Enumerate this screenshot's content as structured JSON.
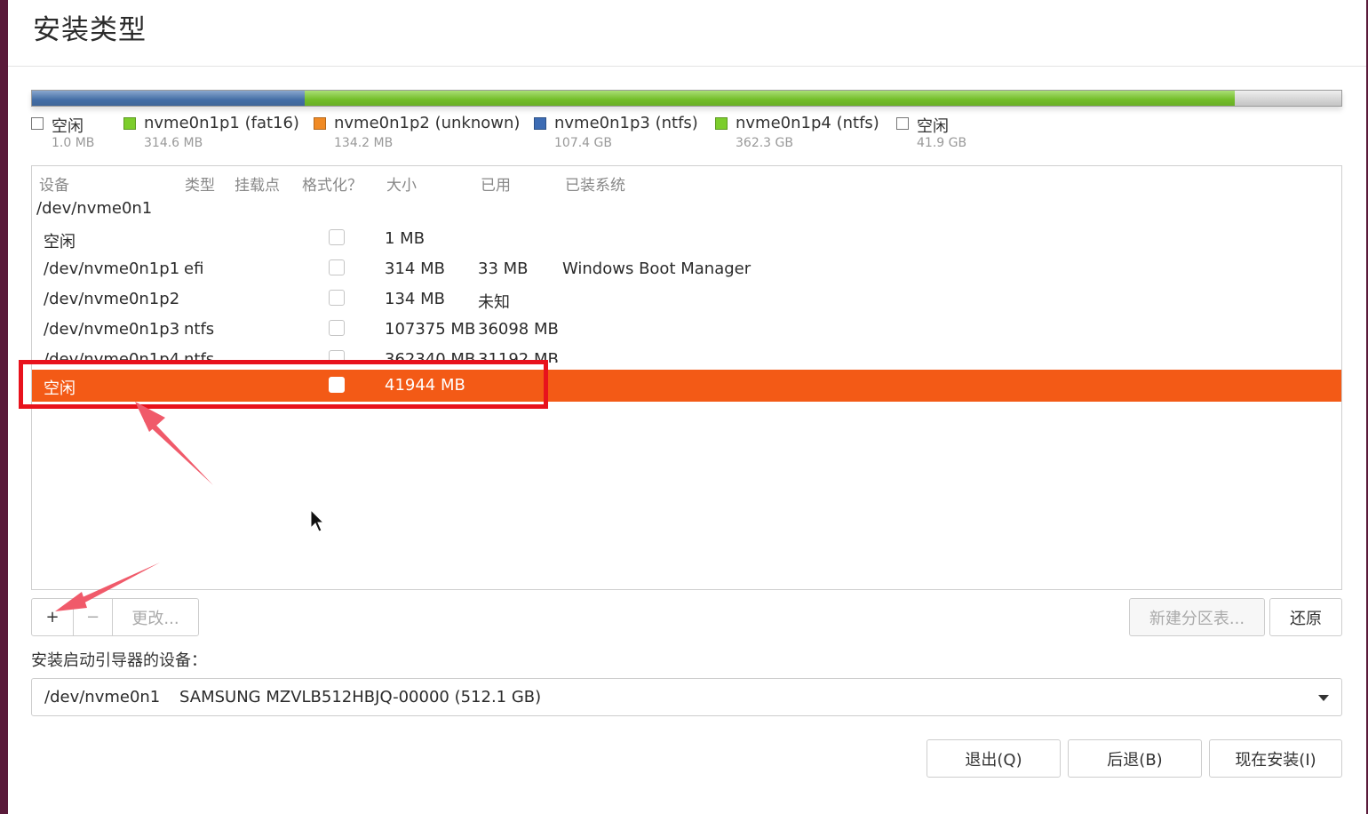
{
  "title": "安装类型",
  "partition_bar": [
    {
      "color": "#ffffff",
      "fraction": 2e-05
    },
    {
      "color": "#4a78b4",
      "fraction": 0.21,
      "grid": true
    },
    {
      "color": "#7ccd2c",
      "fraction": 0.715,
      "grid": true
    },
    {
      "color": "#e6e6e6",
      "fraction": 0.082,
      "grid": true
    }
  ],
  "legend": [
    {
      "name": "空闲",
      "size": "1.0 MB",
      "color": "#ffffff"
    },
    {
      "name": "nvme0n1p1 (fat16)",
      "size": "314.6 MB",
      "color": "#7ccd2c"
    },
    {
      "name": "nvme0n1p2 (unknown)",
      "size": "134.2 MB",
      "color": "#f08a24"
    },
    {
      "name": "nvme0n1p3 (ntfs)",
      "size": "107.4 GB",
      "color": "#3d6cb4"
    },
    {
      "name": "nvme0n1p4 (ntfs)",
      "size": "362.3 GB",
      "color": "#7ccd2c"
    },
    {
      "name": "空闲",
      "size": "41.9 GB",
      "color": "#ffffff"
    }
  ],
  "table": {
    "headers": {
      "device": "设备",
      "type": "类型",
      "mount": "挂载点",
      "format": "格式化？",
      "size": "大小",
      "used": "已用",
      "system": "已装系统"
    },
    "root_device": "/dev/nvme0n1",
    "rows": [
      {
        "device": "空闲",
        "type": "",
        "size": "1 MB",
        "used": "",
        "system": ""
      },
      {
        "device": "/dev/nvme0n1p1",
        "type": "efi",
        "size": "314 MB",
        "used": "33 MB",
        "system": "Windows Boot Manager"
      },
      {
        "device": "/dev/nvme0n1p2",
        "type": "",
        "size": "134 MB",
        "used": "未知",
        "system": ""
      },
      {
        "device": "/dev/nvme0n1p3",
        "type": "ntfs",
        "size": "107375 MB",
        "used": "36098 MB",
        "system": ""
      },
      {
        "device": "/dev/nvme0n1p4",
        "type": "ntfs",
        "size": "362340 MB",
        "used": "31192 MB",
        "system": ""
      },
      {
        "device": "空闲",
        "type": "",
        "size": "41944 MB",
        "used": "",
        "system": ""
      }
    ]
  },
  "toolbar": {
    "add": "+",
    "remove": "−",
    "change": "更改..."
  },
  "new_table_label": "新建分区表...",
  "revert_label": "还原",
  "bootloader": {
    "label": "安装启动引导器的设备：",
    "device": "/dev/nvme0n1",
    "model": "SAMSUNG MZVLB512HBJQ-00000 (512.1 GB)"
  },
  "buttons": {
    "quit": "退出(Q)",
    "back": "后退(B)",
    "install": "现在安装(I)"
  },
  "colors": {
    "selection": "#f35a16",
    "highlight": "#e8121c",
    "arrow": "#f05a6a"
  }
}
